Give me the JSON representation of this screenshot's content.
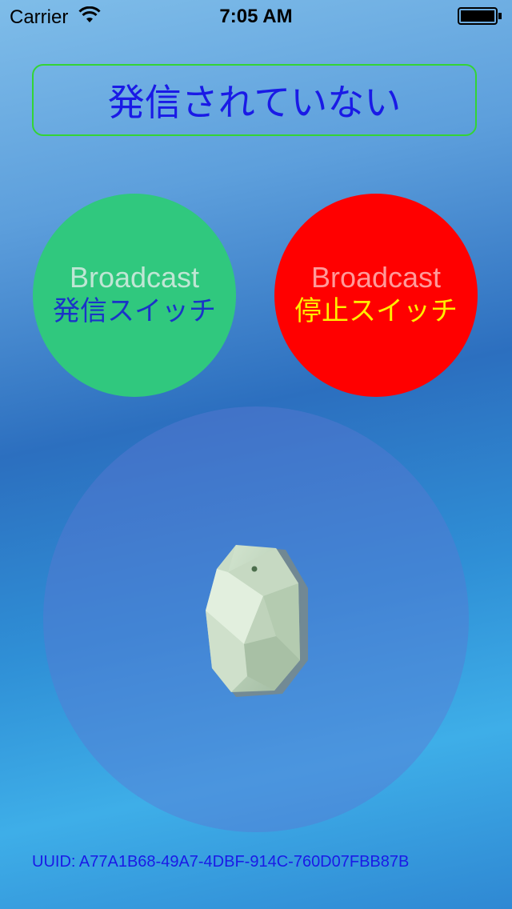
{
  "status_bar": {
    "carrier": "Carrier",
    "time": "7:05 AM",
    "wifi_icon": "wifi-icon",
    "battery_icon": "battery-icon"
  },
  "banner": {
    "text": "発信されていない",
    "border_color": "#34d435",
    "text_color": "#1a1ae6"
  },
  "start_button": {
    "label_en": "Broadcast",
    "label_jp": "発信スイッチ",
    "color": "#30c87e"
  },
  "stop_button": {
    "label_en": "Broadcast",
    "label_jp": "停止スイッチ",
    "color": "#ff0000"
  },
  "beacon": {
    "icon": "beacon-icon"
  },
  "footer": {
    "uuid": "UUID: A77A1B68-49A7-4DBF-914C-760D07FBB87B"
  }
}
